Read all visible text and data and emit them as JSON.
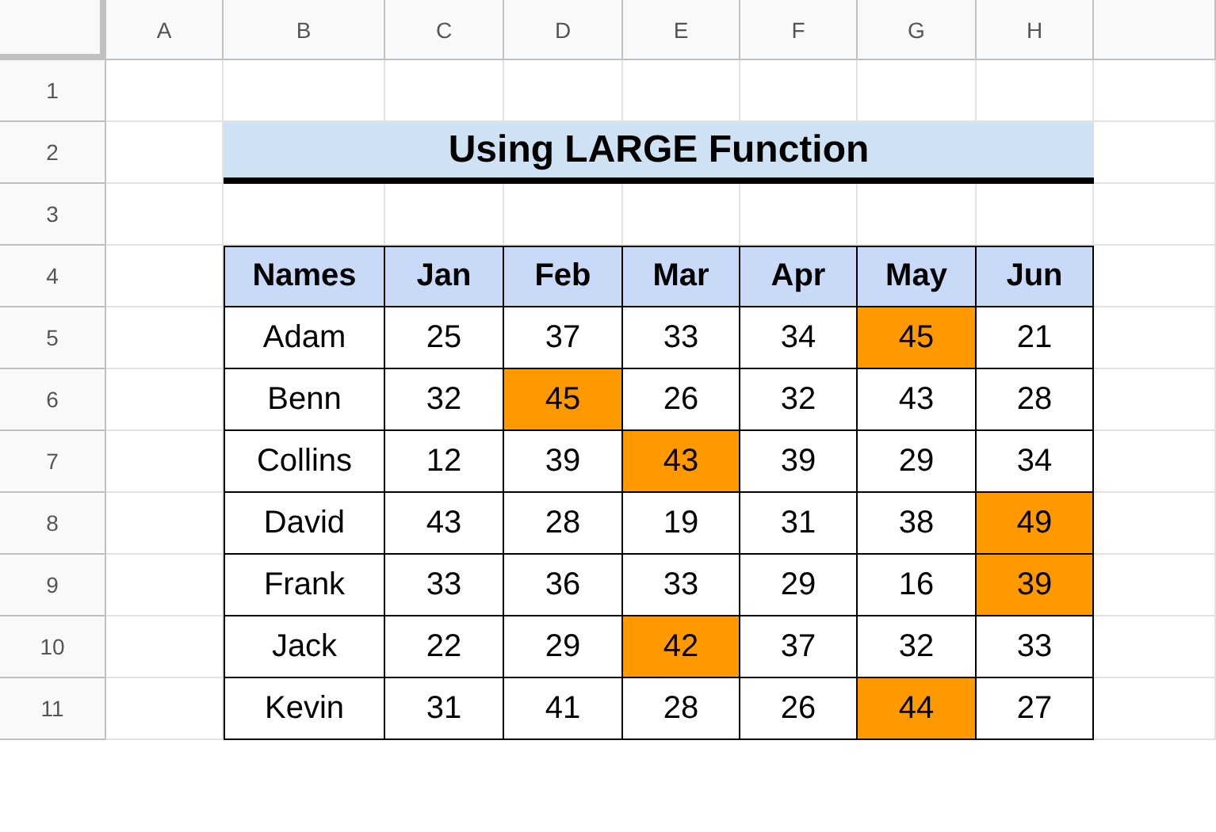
{
  "column_headers": [
    "A",
    "B",
    "C",
    "D",
    "E",
    "F",
    "G",
    "H"
  ],
  "row_headers": [
    "1",
    "2",
    "3",
    "4",
    "5",
    "6",
    "7",
    "8",
    "9",
    "10",
    "11"
  ],
  "title": "Using LARGE Function",
  "table": {
    "columns": [
      "Names",
      "Jan",
      "Feb",
      "Mar",
      "Apr",
      "May",
      "Jun"
    ],
    "rows": [
      {
        "cells": [
          {
            "text": "Adam",
            "highlighted": false
          },
          {
            "text": "25",
            "highlighted": false
          },
          {
            "text": "37",
            "highlighted": false
          },
          {
            "text": "33",
            "highlighted": false
          },
          {
            "text": "34",
            "highlighted": false
          },
          {
            "text": "45",
            "highlighted": true
          },
          {
            "text": "21",
            "highlighted": false
          }
        ]
      },
      {
        "cells": [
          {
            "text": "Benn",
            "highlighted": false
          },
          {
            "text": "32",
            "highlighted": false
          },
          {
            "text": "45",
            "highlighted": true
          },
          {
            "text": "26",
            "highlighted": false
          },
          {
            "text": "32",
            "highlighted": false
          },
          {
            "text": "43",
            "highlighted": false
          },
          {
            "text": "28",
            "highlighted": false
          }
        ]
      },
      {
        "cells": [
          {
            "text": "Collins",
            "highlighted": false
          },
          {
            "text": "12",
            "highlighted": false
          },
          {
            "text": "39",
            "highlighted": false
          },
          {
            "text": "43",
            "highlighted": true
          },
          {
            "text": "39",
            "highlighted": false
          },
          {
            "text": "29",
            "highlighted": false
          },
          {
            "text": "34",
            "highlighted": false
          }
        ]
      },
      {
        "cells": [
          {
            "text": "David",
            "highlighted": false
          },
          {
            "text": "43",
            "highlighted": false
          },
          {
            "text": "28",
            "highlighted": false
          },
          {
            "text": "19",
            "highlighted": false
          },
          {
            "text": "31",
            "highlighted": false
          },
          {
            "text": "38",
            "highlighted": false
          },
          {
            "text": "49",
            "highlighted": true
          }
        ]
      },
      {
        "cells": [
          {
            "text": "Frank",
            "highlighted": false
          },
          {
            "text": "33",
            "highlighted": false
          },
          {
            "text": "36",
            "highlighted": false
          },
          {
            "text": "33",
            "highlighted": false
          },
          {
            "text": "29",
            "highlighted": false
          },
          {
            "text": "16",
            "highlighted": false
          },
          {
            "text": "39",
            "highlighted": true
          }
        ]
      },
      {
        "cells": [
          {
            "text": "Jack",
            "highlighted": false
          },
          {
            "text": "22",
            "highlighted": false
          },
          {
            "text": "29",
            "highlighted": false
          },
          {
            "text": "42",
            "highlighted": true
          },
          {
            "text": "37",
            "highlighted": false
          },
          {
            "text": "32",
            "highlighted": false
          },
          {
            "text": "33",
            "highlighted": false
          }
        ]
      },
      {
        "cells": [
          {
            "text": "Kevin",
            "highlighted": false
          },
          {
            "text": "31",
            "highlighted": false
          },
          {
            "text": "41",
            "highlighted": false
          },
          {
            "text": "28",
            "highlighted": false
          },
          {
            "text": "26",
            "highlighted": false
          },
          {
            "text": "44",
            "highlighted": true
          },
          {
            "text": "27",
            "highlighted": false
          }
        ]
      }
    ]
  }
}
